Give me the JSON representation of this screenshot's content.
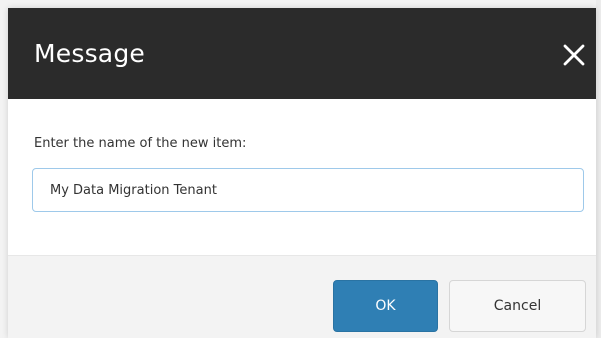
{
  "dialog": {
    "title": "Message",
    "close_icon": "close-icon",
    "prompt": "Enter the name of the new item:",
    "input_value": "My Data Migration Tenant",
    "buttons": {
      "ok": "OK",
      "cancel": "Cancel"
    }
  },
  "colors": {
    "titlebar": "#2b2b2b",
    "primary_button": "#2f7fb4",
    "input_border": "#9ec9ea",
    "footer_background": "#f3f3f3"
  }
}
